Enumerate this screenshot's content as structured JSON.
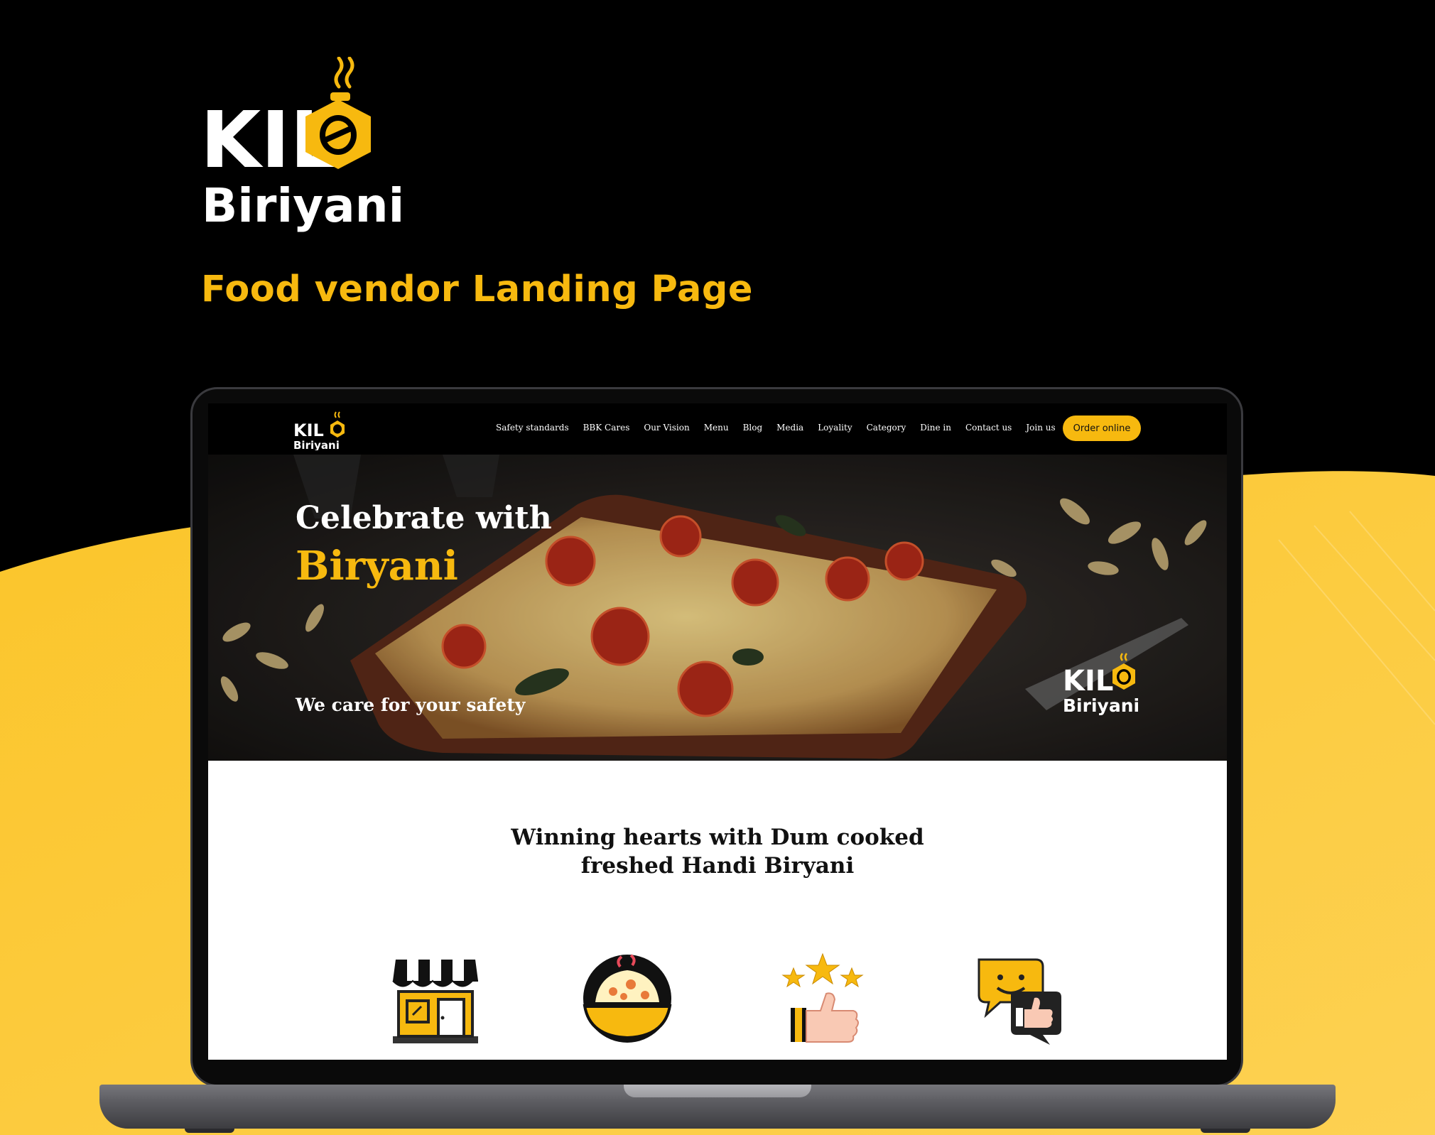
{
  "brand": {
    "logo_text_line1": "KILO",
    "logo_text_line2": "Biriyani",
    "tagline": "Food vendor Landing Page"
  },
  "colors": {
    "accent": "#f7b90f",
    "background_dark": "#000000",
    "background_yellow": "#fbc52a"
  },
  "website": {
    "nav": {
      "links": [
        "Safety standards",
        "BBK Cares",
        "Our Vision",
        "Menu",
        "Blog",
        "Media",
        "Loyality",
        "Category",
        "Dine in",
        "Contact us",
        "Join us"
      ],
      "order_button": "Order online"
    },
    "hero": {
      "title_line1": "Celebrate with",
      "title_line2": "Biryani",
      "subtitle": "We care for your safety"
    },
    "section": {
      "heading_line1": "Winning hearts with Dum cooked",
      "heading_line2": "freshed Handi Biryani"
    },
    "features": [
      {
        "icon": "store-icon"
      },
      {
        "icon": "biryani-bowl-icon"
      },
      {
        "icon": "rating-thumbs-up-icon"
      },
      {
        "icon": "feedback-chat-icon"
      }
    ]
  }
}
